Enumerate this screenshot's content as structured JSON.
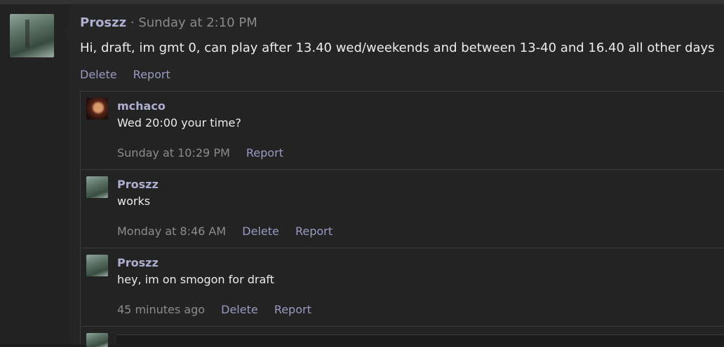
{
  "post": {
    "author": "Proszz",
    "separator": "·",
    "timestamp": "Sunday at 2:10 PM",
    "body": "Hi, draft, im gmt 0, can play after 13.40 wed/weekends and between 13-40 and 16.40 all other days",
    "actions": {
      "delete": "Delete",
      "report": "Report"
    }
  },
  "comments": [
    {
      "author": "mchaco",
      "text": "Wed 20:00 your time?",
      "timestamp": "Sunday at 10:29 PM",
      "actions": {
        "report": "Report"
      }
    },
    {
      "author": "Proszz",
      "text": "works",
      "timestamp": "Monday at 8:46 AM",
      "actions": {
        "delete": "Delete",
        "report": "Report"
      }
    },
    {
      "author": "Proszz",
      "text": "hey, im on smogon for draft",
      "timestamp": "45 minutes ago",
      "actions": {
        "delete": "Delete",
        "report": "Report"
      }
    }
  ]
}
